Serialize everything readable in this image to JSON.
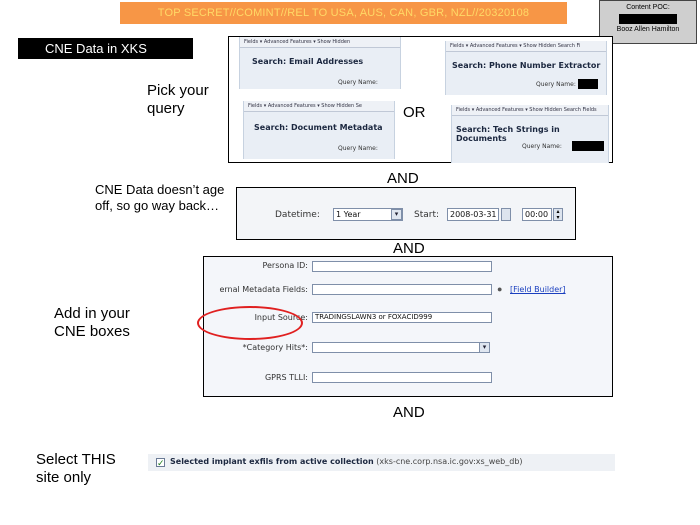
{
  "banner": "TOP SECRET//COMINT//REL TO USA, AUS, CAN, GBR, NZL//20320108",
  "poc": {
    "line1": "Content POC:",
    "line2": "Booz Allen Hamilton"
  },
  "title": "CNE Data in XKS",
  "steps": {
    "pick": "Pick your query",
    "or": "OR",
    "and1": "AND",
    "no_age_off": "CNE Data doesn’t age off, so go way back…",
    "and2": "AND",
    "add_boxes": "Add in your CNE boxes",
    "and3": "AND",
    "select_site": "Select THIS site only"
  },
  "queries": {
    "email": {
      "menu": "Fields  ▾   Advanced Features  ▾   Show Hidden",
      "title": "Search: Email Addresses",
      "query_name": "Query Name:"
    },
    "phone": {
      "menu": "Fields  ▾   Advanced Features  ▾   Show Hidden Search Fi",
      "title": "Search: Phone Number Extractor",
      "query_name": "Query Name:"
    },
    "document": {
      "menu": "Fields  ▾   Advanced Features  ▾   Show Hidden Se",
      "title": "Search: Document Metadata",
      "query_name": "Query Name:"
    },
    "tech": {
      "menu": "Fields  ▾   Advanced Features  ▾   Show Hidden Search Fields",
      "title": "Search: Tech Strings in Documents",
      "query_name": "Query Name:"
    }
  },
  "datetime": {
    "label": "Datetime:",
    "range": "1 Year",
    "start_label": "Start:",
    "start_date": "2008-03-31",
    "start_time": "00:00"
  },
  "form": {
    "persona_label": "Persona ID:",
    "metadata_label": "ernal Metadata Fields:",
    "field_builder": "[Field Builder]",
    "input_source_label": "Input Source:",
    "input_source_value": "TRADINGSLAWN3 or FOXACID999",
    "category_label": "*Category Hits*:",
    "gprs_label": "GPRS TLLI:"
  },
  "site": {
    "checkbox_label": "Selected implant exfils from active collection",
    "db": "(xks-cne.corp.nsa.ic.gov:xs_web_db)",
    "checked": true
  },
  "colors": {
    "banner_bg": "#f79646",
    "banner_text": "#ffd966",
    "annotation_circle": "#e02020"
  }
}
